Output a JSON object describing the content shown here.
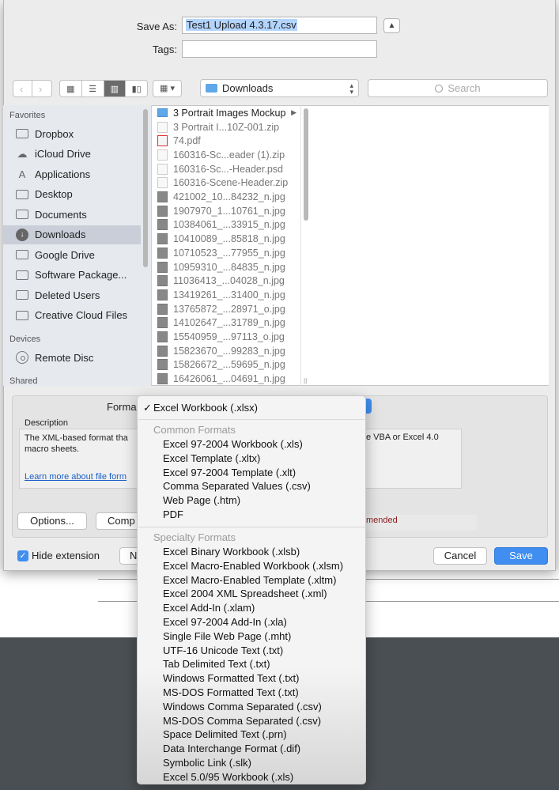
{
  "dialog": {
    "save_as_label": "Save As:",
    "filename": "Test1 Upload 4.3.17.csv",
    "tags_label": "Tags:",
    "tags_value": "",
    "expand_icon": "chevron-up"
  },
  "toolbar": {
    "location": "Downloads",
    "search_placeholder": "Search"
  },
  "sidebar": {
    "favorites_header": "Favorites",
    "favorites": [
      {
        "label": "Dropbox",
        "icon": "folder"
      },
      {
        "label": "iCloud Drive",
        "icon": "cloud"
      },
      {
        "label": "Applications",
        "icon": "applications"
      },
      {
        "label": "Desktop",
        "icon": "folder"
      },
      {
        "label": "Documents",
        "icon": "document"
      },
      {
        "label": "Downloads",
        "icon": "download",
        "selected": true
      },
      {
        "label": "Google Drive",
        "icon": "folder"
      },
      {
        "label": "Software Package...",
        "icon": "folder"
      },
      {
        "label": "Deleted Users",
        "icon": "folder"
      },
      {
        "label": "Creative Cloud Files",
        "icon": "folder"
      }
    ],
    "devices_header": "Devices",
    "devices": [
      {
        "label": "Remote Disc",
        "icon": "disc"
      }
    ],
    "shared_header": "Shared"
  },
  "files": [
    {
      "name": "3 Portrait Images Mockup",
      "type": "folder"
    },
    {
      "name": "3 Portrait I...10Z-001.zip",
      "type": "zip"
    },
    {
      "name": "74.pdf",
      "type": "pdf"
    },
    {
      "name": "160316-Sc...eader (1).zip",
      "type": "zip"
    },
    {
      "name": "160316-Sc...-Header.psd",
      "type": "psd"
    },
    {
      "name": "160316-Scene-Header.zip",
      "type": "zip"
    },
    {
      "name": "421002_10...84232_n.jpg",
      "type": "img"
    },
    {
      "name": "1907970_1...10761_n.jpg",
      "type": "img"
    },
    {
      "name": "10384061_...33915_n.jpg",
      "type": "img"
    },
    {
      "name": "10410089_...85818_n.jpg",
      "type": "img"
    },
    {
      "name": "10710523_...77955_n.jpg",
      "type": "img"
    },
    {
      "name": "10959310_...84835_n.jpg",
      "type": "img"
    },
    {
      "name": "11036413_...04028_n.jpg",
      "type": "img"
    },
    {
      "name": "13419261_...31400_n.jpg",
      "type": "img"
    },
    {
      "name": "13765872_...28971_o.jpg",
      "type": "img"
    },
    {
      "name": "14102647_...31789_n.jpg",
      "type": "img"
    },
    {
      "name": "15540959_...97113_o.jpg",
      "type": "img"
    },
    {
      "name": "15823670_...99283_n.jpg",
      "type": "img"
    },
    {
      "name": "15826672_...59695_n.jpg",
      "type": "img"
    },
    {
      "name": "16426061_...04691_n.jpg",
      "type": "img"
    }
  ],
  "options": {
    "format_label": "Forma",
    "description_label": "Description",
    "description_text_1": "The XML-based format tha",
    "description_text_2": "macro sheets.",
    "description_text_right": "e VBA or Excel 4.0",
    "learn_more": "Learn more about file form",
    "options_button": "Options...",
    "compat_button": "Comp",
    "compat_text": "mended",
    "hide_extension_label": "Hide extension",
    "hide_extension_checked": true,
    "new_folder_button": "N"
  },
  "buttons": {
    "cancel": "Cancel",
    "save": "Save"
  },
  "format_menu": {
    "selected": "Excel Workbook (.xlsx)",
    "check_glyph": "✓",
    "common_header": "Common Formats",
    "common": [
      "Excel 97-2004 Workbook (.xls)",
      "Excel Template (.xltx)",
      "Excel 97-2004 Template (.xlt)",
      "Comma Separated Values (.csv)",
      "Web Page (.htm)",
      "PDF"
    ],
    "specialty_header": "Specialty Formats",
    "specialty": [
      "Excel Binary Workbook (.xlsb)",
      "Excel Macro-Enabled Workbook (.xlsm)",
      "Excel Macro-Enabled Template (.xltm)",
      "Excel 2004 XML Spreadsheet (.xml)",
      "Excel Add-In (.xlam)",
      "Excel 97-2004 Add-In (.xla)",
      "Single File Web Page (.mht)",
      "UTF-16 Unicode Text (.txt)",
      "Tab Delimited Text (.txt)",
      "Windows Formatted Text (.txt)",
      "MS-DOS Formatted Text (.txt)",
      "Windows Comma Separated (.csv)",
      "MS-DOS Comma Separated (.csv)",
      "Space Delimited Text (.prn)",
      "Data Interchange Format (.dif)",
      "Symbolic Link (.slk)",
      "Excel 5.0/95 Workbook (.xls)"
    ]
  },
  "colors": {
    "accent": "#3f8ef0",
    "sidebar_selected": "#c9ced8",
    "link": "#1a5ec8"
  }
}
